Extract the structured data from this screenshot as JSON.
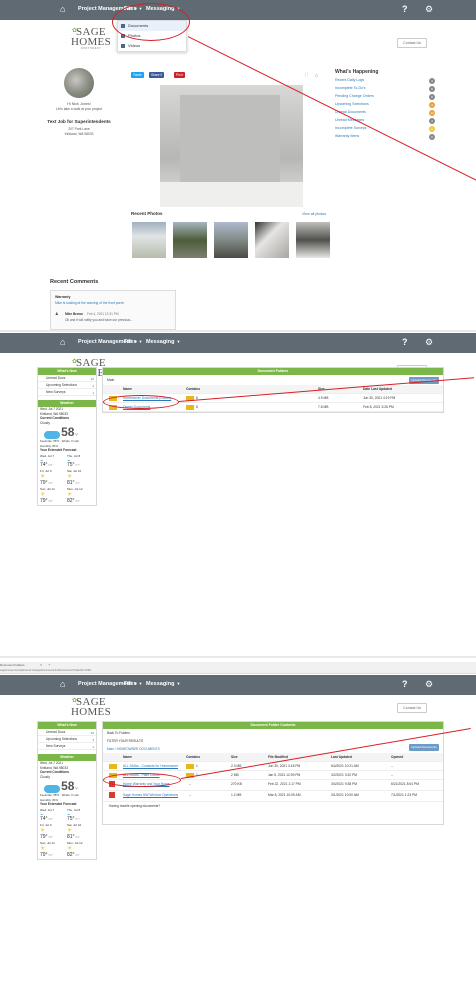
{
  "nav": {
    "home_icon": "home-icon",
    "project_management": "Project Management",
    "files": "Files",
    "messaging": "Messaging",
    "help_label": "?",
    "settings_icon": "gear-icon"
  },
  "logo": {
    "line1": "SAGE",
    "line2": "HOMES",
    "tagline": "NORTHWEST"
  },
  "contact_us": "Contact Us",
  "files_menu": {
    "items": [
      {
        "label": "Documents"
      },
      {
        "label": "Photos"
      },
      {
        "label": "Videos"
      }
    ]
  },
  "panel1": {
    "greeting": "Hi Nick Jones!",
    "walk_text": "Let's take a walk at your project",
    "text_job": "Text Job for Superintendents",
    "address1": "207 Park Lane",
    "address2": "Kirkland, WA 98033",
    "social": [
      "Tweet",
      "Share 0",
      "Pin it"
    ],
    "recent_photos_title": "Recent Photos",
    "view_all": "View all photos",
    "recent_comments_title": "Recent Comments",
    "comment_author": "Warranty",
    "comment_text": "Mike is looking at the warning of the front porch",
    "reply_author": "Mike Brown",
    "reply_date": "Feb 4, 2021 12:31 PM",
    "reply_text": "Ok and it will notify you and have our previous...",
    "whats_happening_title": "What's Happening",
    "whats_happening": [
      {
        "label": "Recent Daily Logs",
        "count": "4"
      },
      {
        "label": "Incomplete To-Do's",
        "count": "6"
      },
      {
        "label": "Pending Change Orders",
        "count": "0"
      },
      {
        "label": "Upcoming Selections",
        "count": "4"
      },
      {
        "label": "Unread Documents",
        "count": "14"
      },
      {
        "label": "Unread Messages",
        "count": "4"
      },
      {
        "label": "Incomplete Surveys",
        "count": "1"
      },
      {
        "label": "Warranty Items",
        "count": "0"
      }
    ]
  },
  "sidebar": {
    "whats_new": "What's New",
    "items": [
      {
        "label": "Unread Docs",
        "badge": "20"
      },
      {
        "label": "Upcoming Selections",
        "badge": "4"
      },
      {
        "label": "New Surveys",
        "badge": "1"
      }
    ],
    "weather_head": "Weather",
    "date": "Wed, Jul 7 2021",
    "location": "Kirkland, WA 98033",
    "current_label": "Current Conditions",
    "current_desc": "Cloudy",
    "temp": "58",
    "temp_unit": "°F",
    "feels": "Feels like: 58°F · Winds: 0 mph",
    "humidity": "Humidity: 81%",
    "forecast_label": "Your Extended Forecast",
    "forecast": [
      {
        "day": "Wed, Jul 7",
        "hi": "74°",
        "lo": "58°"
      },
      {
        "day": "Thu, Jul 8",
        "hi": "75°",
        "lo": "57°"
      },
      {
        "day": "Fri, Jul 9",
        "hi": "79°",
        "lo": "58°"
      },
      {
        "day": "Sat, Jul 10",
        "hi": "81°",
        "lo": "60°"
      },
      {
        "day": "Sun, Jul 11",
        "hi": "79°",
        "lo": "58°"
      },
      {
        "day": "Mon, Jul 12",
        "hi": "82°",
        "lo": "60°"
      }
    ]
  },
  "panel2": {
    "header": "Document Folders",
    "subhead": "Main",
    "upload_btn": "Upload Documents",
    "columns": [
      "Name",
      "Contains",
      "Size",
      "Date Last Updated"
    ],
    "rows": [
      {
        "name": "Homeowner Documents (Owner)",
        "contains": "6",
        "size": "4.9 MB",
        "date": "Jun 30, 2021 4:19 PM"
      },
      {
        "name": "Owner Documents",
        "contains": "5",
        "size": "7.8 MB",
        "date": "Feb 8, 2021 3:26 PM"
      }
    ]
  },
  "panel3": {
    "tab_title": "Document Folders",
    "url": "sagehomesnw.buildertrend.net/app/Documents/FolderContents?folderID=1298...",
    "header": "Document Folder Contents",
    "back": "Back To Folders",
    "filter": "FILTER YOUR RESULTS",
    "breadcrumb": "Main / HOMEOWNER DOCUMENTS",
    "upload_btn": "Upload Documents",
    "columns": [
      "Name",
      "Contains",
      "Size",
      "File Modified",
      "Last Updated",
      "Opened"
    ],
    "rows": [
      {
        "name": "ALL DMAs - Contacts for Homeowner",
        "contains": "1",
        "size": "2.3 MB",
        "modified": "Jun 30, 2021 3:18 PM",
        "updated": "6/4/2021 10:21 AM",
        "opened": "--",
        "type": "folder"
      },
      {
        "name": "ALL DMAs - Paint Colors",
        "contains": "1",
        "size": "2 MB",
        "modified": "Jan 5, 2021 12:09 PM",
        "updated": "3/2/2021 3:20 PM",
        "opened": "--",
        "type": "folder"
      },
      {
        "name": "Home Warranty and Your Home",
        "contains": "--",
        "size": "270 KB",
        "modified": "Feb 22, 2021 1:17 PM",
        "updated": "3/4/2021 9:38 PM",
        "opened": "6/21/2021 8:04 PM",
        "type": "pdf"
      },
      {
        "name": "Sage Homes NW Window Operations",
        "contains": "--",
        "size": "1.2 MB",
        "modified": "Mar 8, 2021 10:09 AM",
        "updated": "3/1/2021 10:00 AM",
        "opened": "7/1/2021 1:23 PM",
        "type": "pdf"
      }
    ],
    "trouble": "Having trouble opening documents?"
  }
}
